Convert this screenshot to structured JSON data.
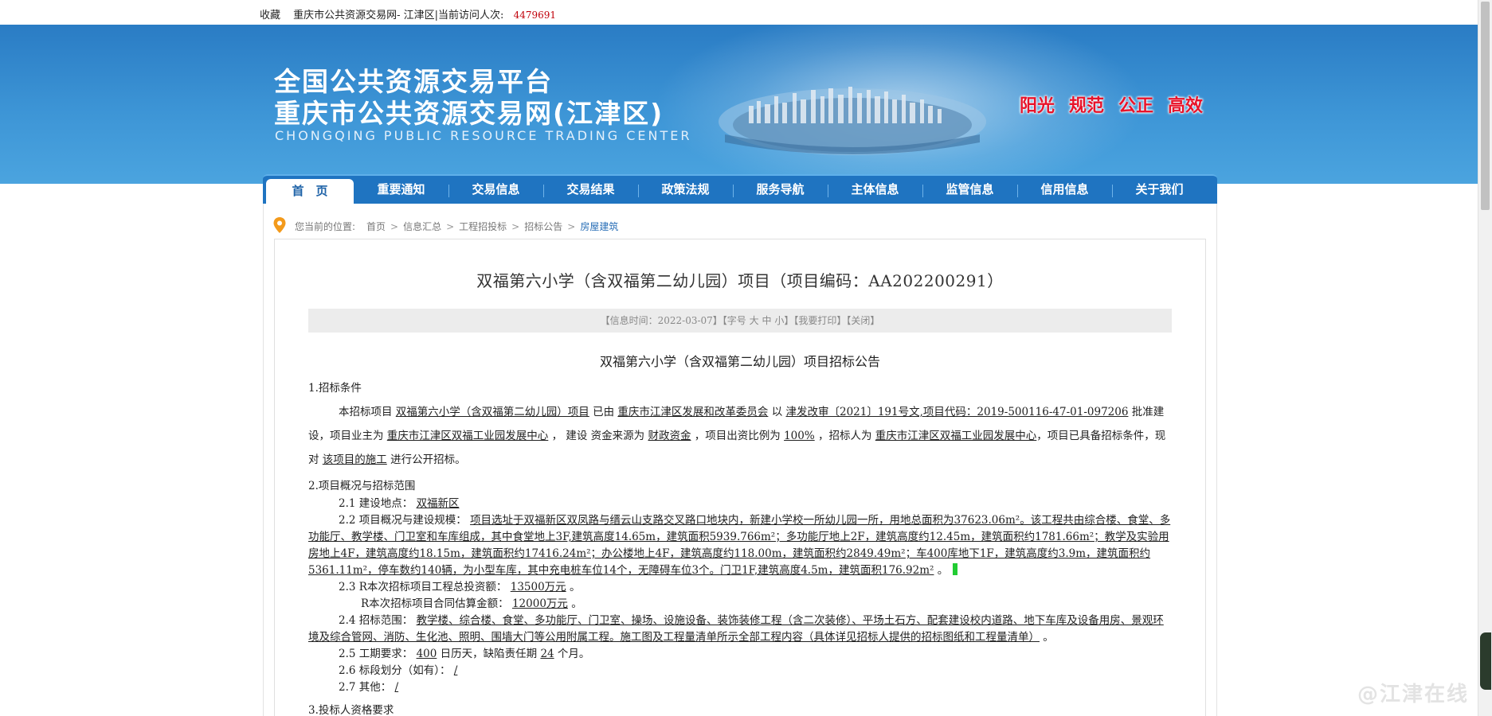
{
  "topbar": {
    "favorite": "收藏",
    "site_info": "重庆市公共资源交易网- 江津区|当前访问人次:",
    "visit_count": "4479691"
  },
  "header": {
    "title_line1": "全国公共资源交易平台",
    "title_line2": "重庆市公共资源交易网(江津区)",
    "title_en": "CHONGQING PUBLIC RESOURCE TRADING CENTER",
    "slogans": [
      "阳光",
      "规范",
      "公正",
      "高效"
    ],
    "slogan_color": "#e8132a",
    "header_color": "#2a7cc4"
  },
  "nav": {
    "items": [
      "首　页",
      "重要通知",
      "交易信息",
      "交易结果",
      "政策法规",
      "服务导航",
      "主体信息",
      "监管信息",
      "信用信息",
      "关于我们"
    ],
    "active_index": 0
  },
  "breadcrumb": {
    "label": "您当前的位置:",
    "items": [
      "首页",
      "信息汇总",
      "工程招投标",
      "招标公告",
      "房屋建筑"
    ]
  },
  "article": {
    "title": "双福第六小学（含双福第二幼儿园）项目（项目编码：AA202200291）",
    "meta_prefix": "【信息时间：2022-03-07】【字号",
    "font_large": "大",
    "font_medium": "中",
    "font_small": "小",
    "meta_print": "】【我要打印】",
    "meta_close": "【关闭】",
    "subtitle": "双福第六小学（含双福第二幼儿园）项目招标公告",
    "s1_title": "1.招标条件",
    "s1_a": "本招标项目",
    "s1_project": "双福第六小学（含双福第二幼儿园）项目",
    "s1_b": "已由",
    "s1_approver": "重庆市江津区发展和改革委员会",
    "s1_c": "以",
    "s1_doc": "津发改审〔2021〕191号文,项目代码：2019-500116-47-01-097206",
    "s1_d": "批准建设，项目业主为",
    "s1_owner": "重庆市江津区双福工业园发展中心",
    "s1_e": "，  建设 资金来源为",
    "s1_fund": "财政资金",
    "s1_f": "，项目出资比例为",
    "s1_ratio": "100%",
    "s1_g": "，招标人为",
    "s1_tenderer": "重庆市江津区双福工业园发展中心",
    "s1_h": "，项目已具备招标条件，现对",
    "s1_scope": "该项目的施工",
    "s1_i": "进行公开招标。",
    "s2_title": "2.项目概况与招标范围",
    "s21_label": "2.1 建设地点：",
    "s21_value": "双福新区",
    "s22_label": "2.2 项目概况与建设规模：",
    "s22_value": "项目选址于双福新区双凤路与缙云山支路交叉路口地块内，新建小学校一所幼儿园一所，用地总面积为37623.06m²。该工程共由综合楼、食堂、多功能厅、教学楼、门卫室和车库组成，其中食堂地上3F,建筑高度14.65m，建筑面积5939.766m²；多功能厅地上2F，建筑高度约12.45m，建筑面积约1781.66m²；教学及实验用房地上4F，建筑高度约18.15m，建筑面积约17416.24m²；办公楼地上4F，建筑高度约118.00m，建筑面积约2849.49m²；车400库地下1F，建筑高度约3.9m，建筑面积约5361.11m²，停车数约140辆，为小型车库，其中充电桩车位14个，无障碍车位3个。门卫1F,建筑高度4.5m，建筑面积176.92m²",
    "s22_end": "。",
    "s23_label": "2.3 R本次招标项目工程总投资额：",
    "s23_value": "13500万元",
    "s23_end": "。",
    "s23b_label": "R本次招标项目合同估算金额：",
    "s23b_value": "12000万元",
    "s23b_end": "。",
    "s24_label": "2.4 招标范围：",
    "s24_value": "教学楼、综合楼、食堂、多功能厅、门卫室、操场、设施设备、装饰装修工程（含二次装修）、平场土石方、配套建设校内道路、地下车库及设备用房、景观环境及综合管网、消防、生化池、照明、围墙大门等公用附属工程。施工图及工程量清单所示全部工程内容（具体详见招标人提供的招标图纸和工程量清单）",
    "s24_end": "。",
    "s25_label": "2.5 工期要求：",
    "s25_days": "400",
    "s25_mid": "日历天，缺陷责任期",
    "s25_months": "24",
    "s25_end": "个月。",
    "s26_label": "2.6 标段划分（如有）：",
    "s26_value": "/",
    "s27_label": "2.7 其他：",
    "s27_value": "/",
    "s3_title": "3.投标人资格要求"
  },
  "watermark": "@江津在线"
}
